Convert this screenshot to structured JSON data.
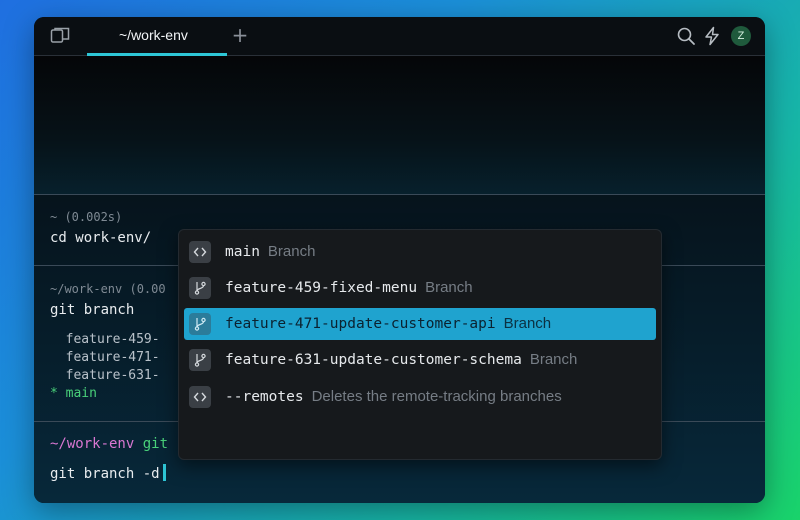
{
  "tabbar": {
    "tab_title": "~/work-env",
    "new_tab_glyph": "+",
    "avatar_initial": "Z",
    "icons": [
      "split-pane-icon",
      "search-icon",
      "bolt-icon"
    ]
  },
  "blocks": [
    {
      "meta": "~ (0.002s)",
      "command": "cd work-env/"
    },
    {
      "meta": "~/work-env (0.00",
      "command": "git branch",
      "output": [
        "  feature-459-",
        "  feature-471-",
        "  feature-631-"
      ],
      "current_marker": "* ",
      "current_branch": "main"
    }
  ],
  "active_prompt": {
    "path": "~/work-env",
    "git": "git",
    "input": "git branch -d"
  },
  "suggestions": [
    {
      "text": "main",
      "desc": "Branch",
      "icon": "code-icon",
      "selected": false
    },
    {
      "text": "feature-459-fixed-menu",
      "desc": "Branch",
      "icon": "git-branch-icon",
      "selected": false
    },
    {
      "text": "feature-471-update-customer-api",
      "desc": "Branch",
      "icon": "git-branch-icon",
      "selected": true
    },
    {
      "text": "feature-631-update-customer-schema",
      "desc": "Branch",
      "icon": "git-branch-icon",
      "selected": false
    },
    {
      "text": "--remotes",
      "desc": "Deletes the remote-tracking branches",
      "icon": "code-icon",
      "selected": false
    }
  ],
  "colors": {
    "accent": "#2ec6d6",
    "selection": "#1fa3cf",
    "prompt_path": "#d977d2",
    "prompt_git": "#49d17a"
  }
}
